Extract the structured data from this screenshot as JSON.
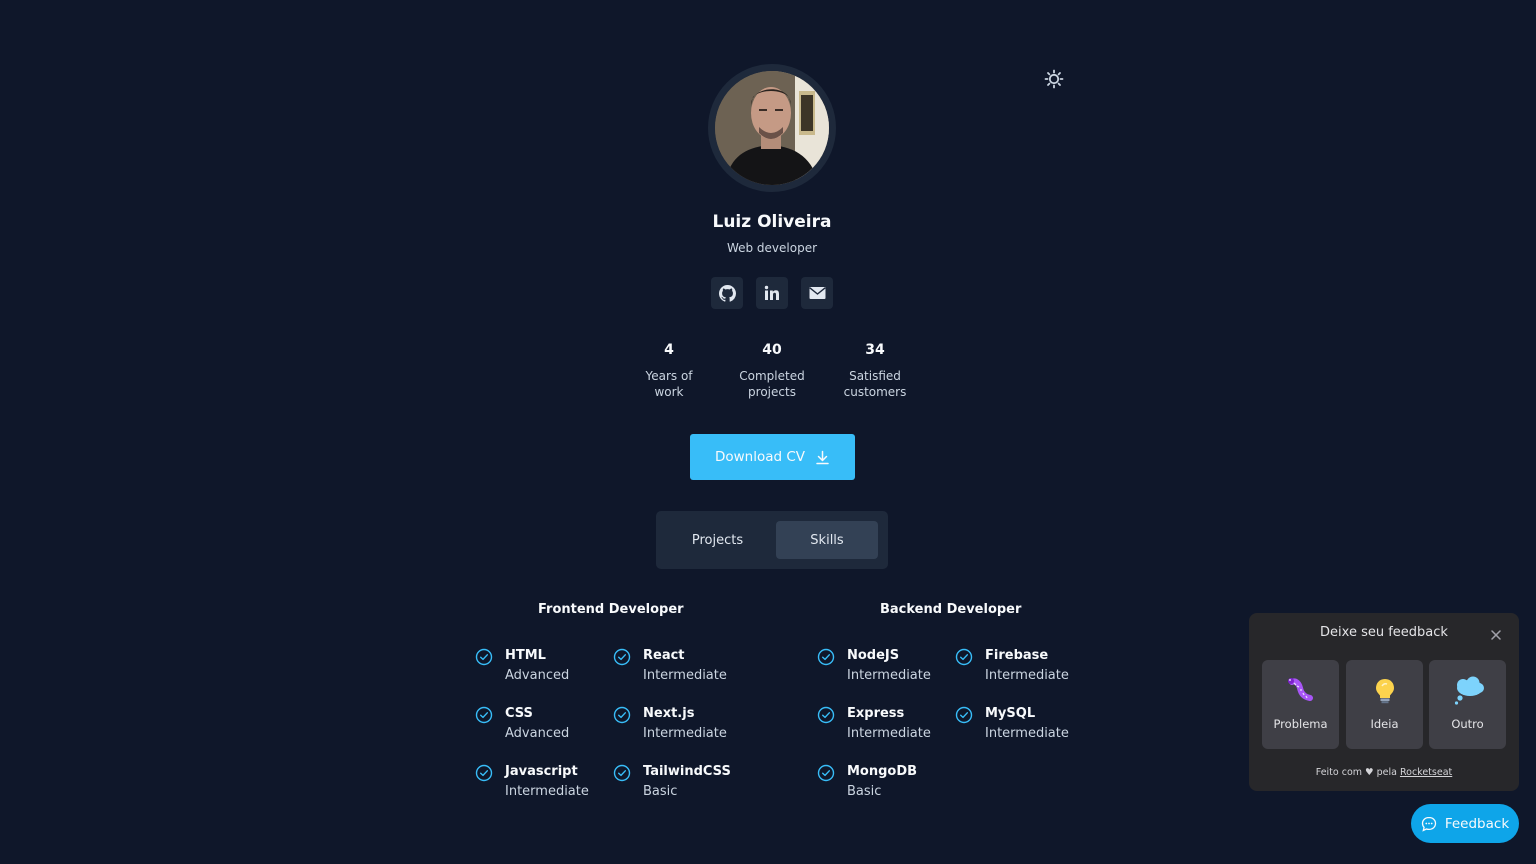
{
  "profile": {
    "name": "Luiz Oliveira",
    "role": "Web developer",
    "social": [
      "github-icon",
      "linkedin-icon",
      "mail-icon"
    ]
  },
  "stats": [
    {
      "value": "4",
      "label_line1": "Years of",
      "label_line2": "work"
    },
    {
      "value": "40",
      "label_line1": "Completed",
      "label_line2": "projects"
    },
    {
      "value": "34",
      "label_line1": "Satisfied",
      "label_line2": "customers"
    }
  ],
  "download": {
    "label": "Download CV"
  },
  "tabs": [
    {
      "label": "Projects"
    },
    {
      "label": "Skills",
      "active": true
    }
  ],
  "skills": {
    "frontend": {
      "title": "Frontend Developer",
      "items": [
        {
          "name": "HTML",
          "level": "Advanced"
        },
        {
          "name": "React",
          "level": "Intermediate"
        },
        {
          "name": "CSS",
          "level": "Advanced"
        },
        {
          "name": "Next.js",
          "level": "Intermediate"
        },
        {
          "name": "Javascript",
          "level": "Intermediate"
        },
        {
          "name": "TailwindCSS",
          "level": "Basic"
        }
      ]
    },
    "backend": {
      "title": "Backend Developer",
      "items": [
        {
          "name": "NodeJS",
          "level": "Intermediate"
        },
        {
          "name": "Firebase",
          "level": "Intermediate"
        },
        {
          "name": "Express",
          "level": "Intermediate"
        },
        {
          "name": "MySQL",
          "level": "Intermediate"
        },
        {
          "name": "MongoDB",
          "level": "Basic"
        }
      ]
    }
  },
  "feedback_widget": {
    "title": "Deixe seu feedback",
    "options": [
      {
        "label": "Problema",
        "icon": "bug-icon"
      },
      {
        "label": "Ideia",
        "icon": "lightbulb-icon"
      },
      {
        "label": "Outro",
        "icon": "thought-cloud-icon"
      }
    ],
    "footer_prefix": "Feito com ♥ pela",
    "footer_link": "Rocketseat",
    "button_label": "Feedback"
  },
  "colors": {
    "background": "#0f172a",
    "accent": "#38bdf8",
    "card": "#1e293b"
  }
}
